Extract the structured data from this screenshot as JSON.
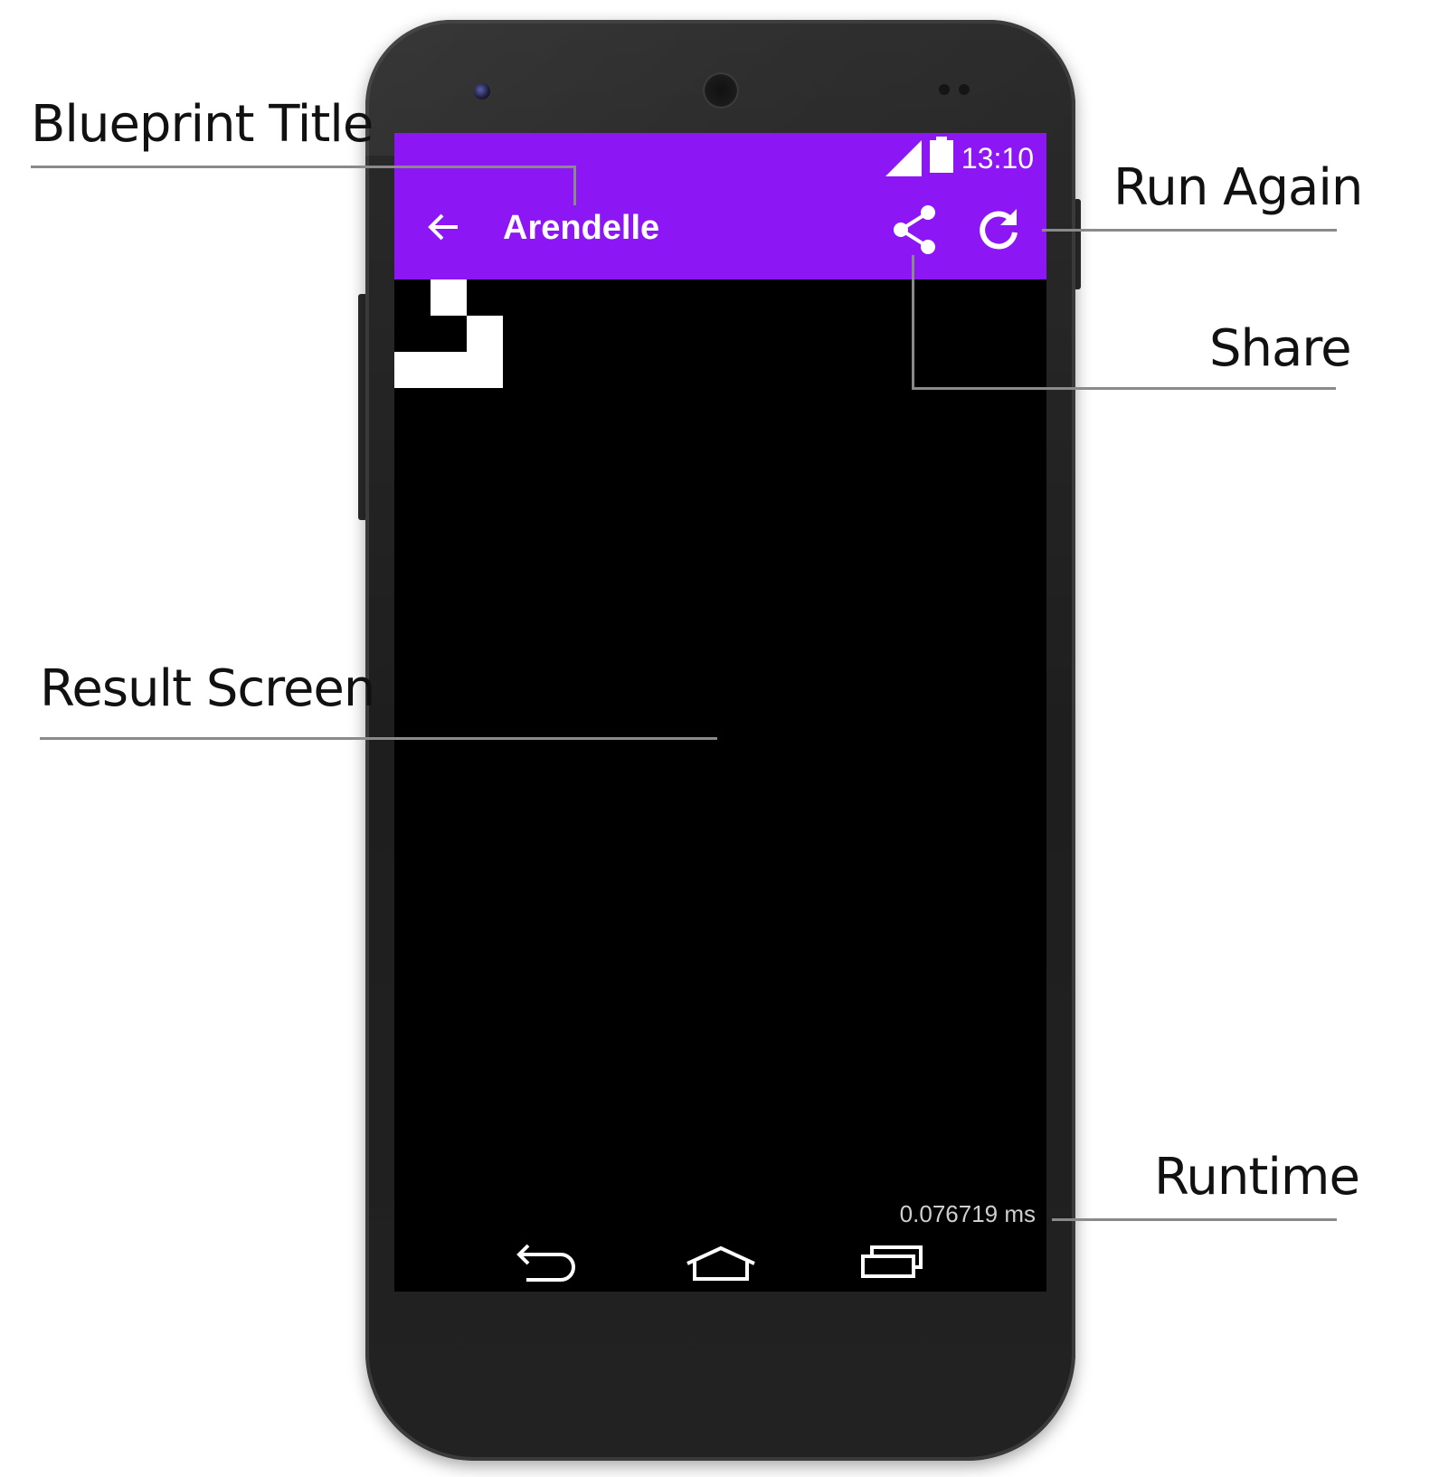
{
  "status_bar": {
    "time": "13:10"
  },
  "app_bar": {
    "title": "Arendelle",
    "accent_color": "#8c17f4"
  },
  "result_screen": {
    "background": "#000000",
    "runtime": "0.076719 ms"
  },
  "icons": {
    "back": "back-arrow-icon",
    "share": "share-icon",
    "run_again": "refresh-icon",
    "signal": "signal-icon",
    "battery": "battery-icon",
    "nav_back": "nav-back-icon",
    "nav_home": "nav-home-icon",
    "nav_recents": "nav-recents-icon"
  },
  "callouts": {
    "blueprint_title": "Blueprint Title",
    "run_again": "Run Again",
    "share": "Share",
    "result_screen": "Result Screen",
    "runtime": "Runtime"
  }
}
